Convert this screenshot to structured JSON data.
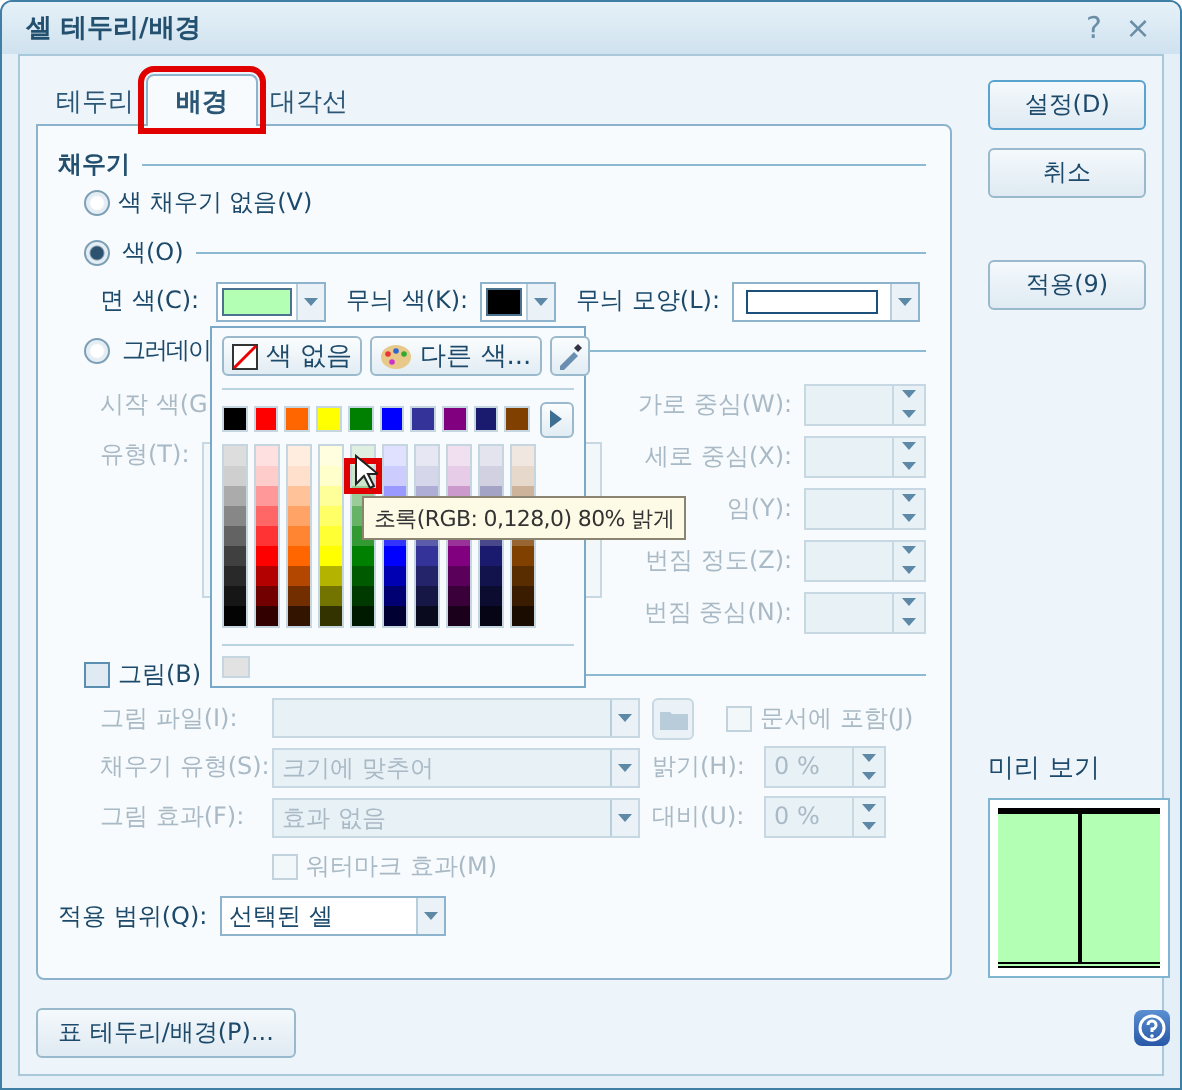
{
  "window": {
    "title": "셀 테두리/배경",
    "controls": [
      "?",
      "×"
    ]
  },
  "tabs": [
    {
      "label": "테두리",
      "selected": false,
      "marked": false
    },
    {
      "label": "배경",
      "selected": true,
      "marked": true
    },
    {
      "label": "대각선",
      "selected": false,
      "marked": false
    }
  ],
  "fill": {
    "title": "채우기",
    "no_fill": {
      "label": "색 채우기 없음(V)",
      "selected": false
    },
    "color": {
      "label": "색(O)",
      "selected": true,
      "face": {
        "label": "면 색(C):",
        "color": "#b3ffb3"
      },
      "pattern_color": {
        "label": "무늬 색(K):",
        "color": "#000000"
      },
      "pattern_shape": {
        "label": "무늬 모양(L):"
      }
    },
    "gradient": {
      "label": "그러데이",
      "selected": false,
      "start": {
        "label": "시작 색(G"
      },
      "type": {
        "label": "유형(T):"
      },
      "spins": [
        {
          "label": "가로 중심(W):"
        },
        {
          "label": "세로 중심(X):"
        },
        {
          "label": "임(Y):"
        },
        {
          "label": "번짐 정도(Z):"
        },
        {
          "label": "번짐 중심(N):"
        }
      ]
    },
    "picture": {
      "label": "그림(B)",
      "checked": false,
      "file": {
        "label": "그림 파일(I):"
      },
      "embed": {
        "label": "문서에 포함(J)",
        "checked": false
      },
      "fill_type": {
        "label": "채우기 유형(S):",
        "value": "크기에 맞추어"
      },
      "brightness": {
        "label": "밝기(H):",
        "value": "0 %"
      },
      "effect": {
        "label": "그림 효과(F):",
        "value": "효과 없음"
      },
      "contrast": {
        "label": "대비(U):",
        "value": "0 %"
      },
      "watermark": {
        "label": "워터마크 효과(M)",
        "checked": false
      }
    },
    "scope": {
      "label": "적용 범위(Q):",
      "value": "선택된 셀"
    }
  },
  "table_button": "표 테두리/배경(P)...",
  "buttons": [
    {
      "label": "설정(D)",
      "default": true
    },
    {
      "label": "취소",
      "default": false
    },
    {
      "label": "적용(9)",
      "default": false
    }
  ],
  "preview": {
    "title": "미리 보기",
    "color": "#b3ffb3"
  },
  "palette": {
    "no_color": "색 없음",
    "more_colors": "다른 색...",
    "tooltip": "초록(RGB: 0,128,0) 80% 밝게",
    "shade_rows": [
      {
        "selected": false
      },
      {
        "selected": true
      },
      {
        "selected": false
      },
      {
        "selected": false
      },
      {
        "selected": false
      },
      {
        "selected": false
      },
      {
        "selected": false
      },
      {
        "selected": false
      },
      {
        "selected": false
      }
    ],
    "colors": [
      {
        "color": "#000000",
        "selected": false
      },
      {
        "color": "#ff0000",
        "selected": false
      },
      {
        "color": "#ff6600",
        "selected": false
      },
      {
        "color": "#ffff00",
        "selected": false
      },
      {
        "color": "#008000",
        "selected": true
      },
      {
        "color": "#0000ff",
        "selected": false
      },
      {
        "color": "#333399",
        "selected": false
      },
      {
        "color": "#800080",
        "selected": false
      },
      {
        "color": "#1a1a6e",
        "selected": false
      },
      {
        "color": "#804000",
        "selected": false
      }
    ]
  }
}
